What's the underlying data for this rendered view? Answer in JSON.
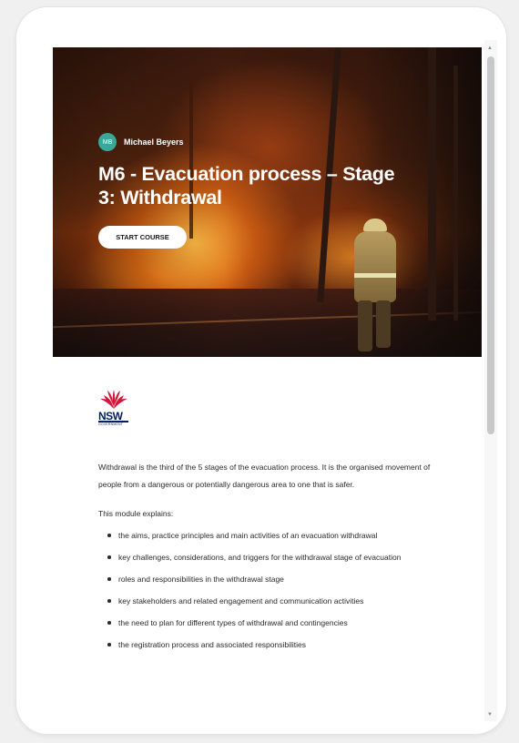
{
  "course": {
    "author_initials": "MB",
    "author_name": "Michael Beyers",
    "title": "M6 - Evacuation process – Stage 3: Withdrawal",
    "start_button": "START COURSE"
  },
  "logo": {
    "word": "NSW",
    "sub": "GOVERNMENT",
    "colors": {
      "waratah_red": "#d7153a",
      "navy": "#00205b"
    }
  },
  "content": {
    "intro": "Withdrawal is the third of the 5 stages of the evacuation process. It is the organised movement of people from a dangerous or potentially dangerous area to one that is safer.",
    "explains_heading": "This module explains:",
    "bullets": [
      "the aims, practice principles and main activities of an evacuation withdrawal",
      "key challenges, considerations, and triggers for the withdrawal stage of evacuation",
      "roles and responsibilities in the withdrawal stage",
      "key stakeholders and related engagement and communication activities",
      "the need to plan for different types of withdrawal and contingencies",
      "the registration process and associated responsibilities"
    ]
  },
  "scrollbar": {
    "up_icon": "triangle-up-icon",
    "down_icon": "triangle-down-icon"
  },
  "colors": {
    "avatar": "#3aa79a",
    "text": "#2b2b2b"
  }
}
